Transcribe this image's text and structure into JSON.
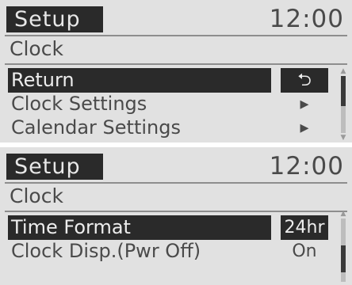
{
  "screens": [
    {
      "header": {
        "title": "Setup",
        "time": "12:00"
      },
      "section_title": "Clock",
      "rows": [
        {
          "label": "Return",
          "value_icon": "return-arrow-icon",
          "value": "",
          "selected": true
        },
        {
          "label": "Clock Settings",
          "value_icon": "chevron-right-icon",
          "value": "",
          "selected": false
        },
        {
          "label": "Calendar Settings",
          "value_icon": "chevron-right-icon",
          "value": "",
          "selected": false
        }
      ]
    },
    {
      "header": {
        "title": "Setup",
        "time": "12:00"
      },
      "section_title": "Clock",
      "rows": [
        {
          "label": "Time Format",
          "value": "24hr",
          "selected": true
        },
        {
          "label": "Clock Disp.(Pwr Off)",
          "value": "On",
          "selected": false
        }
      ]
    }
  ],
  "icons": {
    "return": "⮌",
    "chevron": "▸",
    "scroll_up": "▲",
    "scroll_down": "▼"
  },
  "colors": {
    "screen_bg": "#e1e1e1",
    "highlight_bg": "#2a2a2a",
    "highlight_text": "#ededed",
    "text": "#4a4a4a"
  }
}
